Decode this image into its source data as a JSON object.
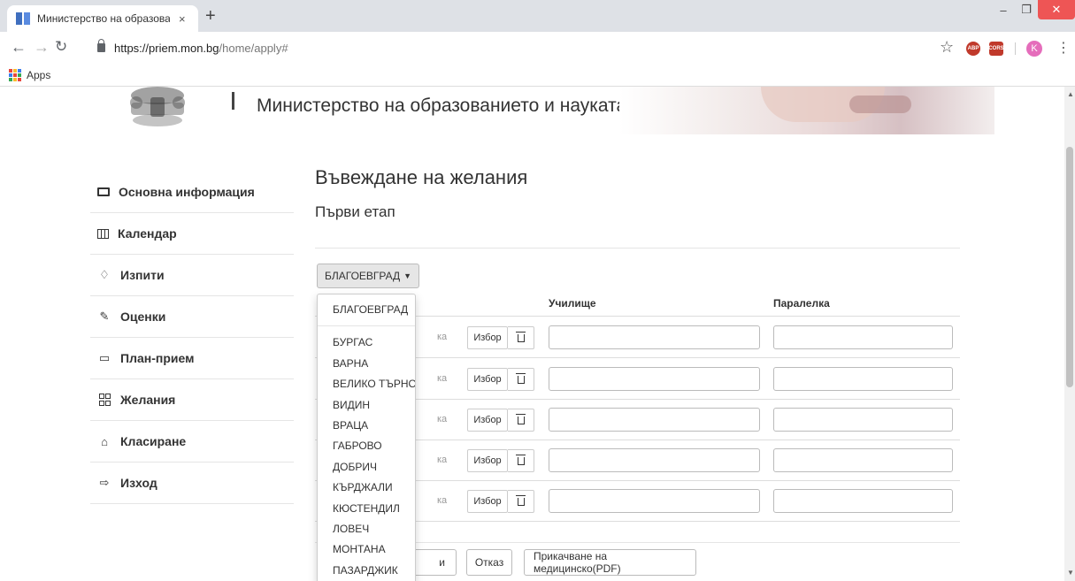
{
  "browser": {
    "tab_title": "Министерство на образованието",
    "tab_close": "×",
    "new_tab": "+",
    "url_host": "https://priem.mon.bg",
    "url_path": "/home/apply#",
    "bookmarks_apps": "Apps",
    "avatar_letter": "K",
    "ext_abp": "ABP",
    "ext_cors": "CORS",
    "apps_grid_colors": [
      "#e8453c",
      "#f9bb2d",
      "#3b7ded",
      "#3b7ded",
      "#e8453c",
      "#33a853",
      "#33a853",
      "#f9bb2d",
      "#e8453c"
    ]
  },
  "header": {
    "ministry_title": "Министерство на образованието и науката"
  },
  "sidebar": {
    "items": [
      {
        "label": "Основна информация",
        "icon": "monitor-icon"
      },
      {
        "label": "Календар",
        "icon": "calendar-icon"
      },
      {
        "label": "Изпити",
        "icon": "bell-icon"
      },
      {
        "label": "Оценки",
        "icon": "edit-icon"
      },
      {
        "label": "План-прием",
        "icon": "folder-open-icon"
      },
      {
        "label": "Желания",
        "icon": "grid-icon"
      },
      {
        "label": "Класиране",
        "icon": "bank-icon"
      },
      {
        "label": "Изход",
        "icon": "logout-icon"
      }
    ]
  },
  "main": {
    "page_title": "Въвеждане на желания",
    "stage_title": "Първи етап",
    "city_selected": "БЛАГОЕВГРАД",
    "col_school": "Училище",
    "col_class": "Паралелка",
    "row_hint": "ка",
    "choose_label": "Избор",
    "rows": 5,
    "save_label": "и",
    "cancel_label": "Отказ",
    "attach_label": "Прикачване на медицинско(PDF)"
  },
  "city_menu": {
    "first": "БЛАГОЕВГРАД",
    "items": [
      "БУРГАС",
      "ВАРНА",
      "ВЕЛИКО ТЪРНОВО",
      "ВИДИН",
      "ВРАЦА",
      "ГАБРОВО",
      "ДОБРИЧ",
      "КЪРДЖАЛИ",
      "КЮСТЕНДИЛ",
      "ЛОВЕЧ",
      "МОНТАНА",
      "ПАЗАРДЖИК"
    ]
  },
  "colors": {
    "accent_tab": "#dee1e6",
    "close_btn": "#e55555",
    "favicon": "#3f6fbf"
  }
}
